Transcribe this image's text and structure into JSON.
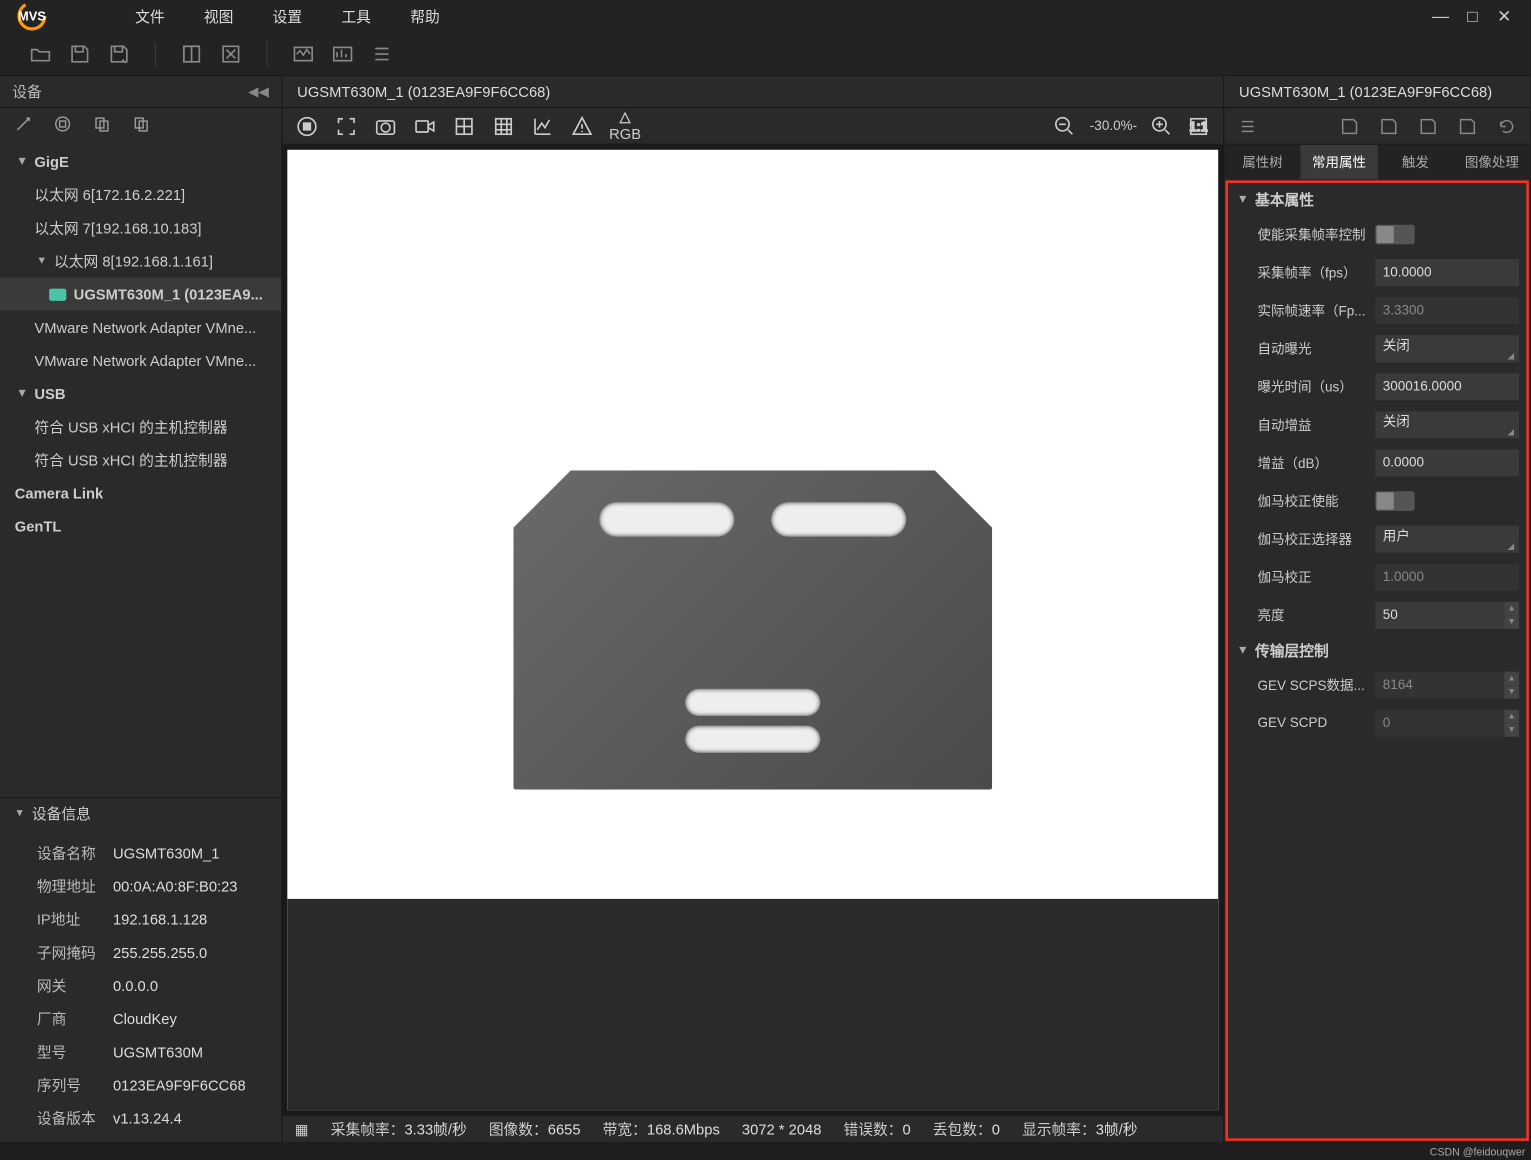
{
  "menu": {
    "file": "文件",
    "view": "视图",
    "settings": "设置",
    "tools": "工具",
    "help": "帮助"
  },
  "sidebar": {
    "title": "设备",
    "gige": "GigE",
    "eth6": "以太网 6[172.16.2.221]",
    "eth7": "以太网 7[192.168.10.183]",
    "eth8": "以太网 8[192.168.1.161]",
    "camera": "UGSMT630M_1 (0123EA9...",
    "vmnet1": "VMware Network Adapter VMne...",
    "vmnet2": "VMware Network Adapter VMne...",
    "usb": "USB",
    "usbctrl1": "符合 USB xHCI 的主机控制器",
    "usbctrl2": "符合 USB xHCI 的主机控制器",
    "camlink": "Camera Link",
    "gentl": "GenTL"
  },
  "devinfo": {
    "header": "设备信息",
    "name_k": "设备名称",
    "name_v": "UGSMT630M_1",
    "mac_k": "物理地址",
    "mac_v": "00:0A:A0:8F:B0:23",
    "ip_k": "IP地址",
    "ip_v": "192.168.1.128",
    "mask_k": "子网掩码",
    "mask_v": "255.255.255.0",
    "gw_k": "网关",
    "gw_v": "0.0.0.0",
    "vendor_k": "厂商",
    "vendor_v": "CloudKey",
    "model_k": "型号",
    "model_v": "UGSMT630M",
    "sn_k": "序列号",
    "sn_v": "0123EA9F9F6CC68",
    "ver_k": "设备版本",
    "ver_v": "v1.13.24.4"
  },
  "tabs": {
    "main": "UGSMT630M_1 (0123EA9F9F6CC68)",
    "right": "UGSMT630M_1 (0123EA9F9F6CC68)"
  },
  "zoom": "-30.0%-",
  "rgb": "RGB",
  "status": {
    "fps_k": "采集帧率：",
    "fps_v": "3.33帧/秒",
    "cnt_k": "图像数：",
    "cnt_v": "6655",
    "bw_k": "带宽：",
    "bw_v": "168.6Mbps",
    "res": "3072 * 2048",
    "err_k": "错误数：",
    "err_v": "0",
    "lost_k": "丢包数：",
    "lost_v": "0",
    "dfps_k": "显示帧率：",
    "dfps_v": "3帧/秒"
  },
  "rtabs": {
    "tree": "属性树",
    "common": "常用属性",
    "trigger": "触发",
    "image": "图像处理"
  },
  "props": {
    "basic_hdr": "基本属性",
    "fps_en": "使能采集帧率控制",
    "fps_k": "采集帧率（fps）",
    "fps_v": "10.0000",
    "afps_k": "实际帧速率（Fp...",
    "afps_v": "3.3300",
    "aexp_k": "自动曝光",
    "aexp_v": "关闭",
    "exp_k": "曝光时间（us）",
    "exp_v": "300016.0000",
    "again_k": "自动增益",
    "again_v": "关闭",
    "gain_k": "增益（dB）",
    "gain_v": "0.0000",
    "gamma_en_k": "伽马校正使能",
    "gamma_sel_k": "伽马校正选择器",
    "gamma_sel_v": "用户",
    "gamma_k": "伽马校正",
    "gamma_v": "1.0000",
    "bright_k": "亮度",
    "bright_v": "50",
    "trans_hdr": "传输层控制",
    "scps_k": "GEV SCPS数据...",
    "scps_v": "8164",
    "scpd_k": "GEV SCPD",
    "scpd_v": "0"
  },
  "watermark": "CSDN @feidouqwer"
}
